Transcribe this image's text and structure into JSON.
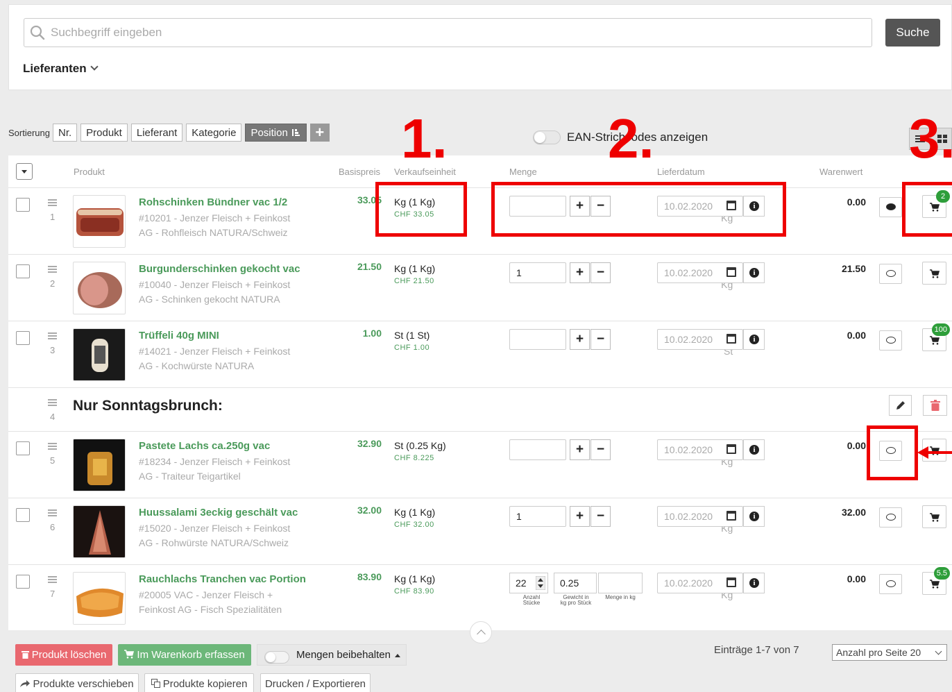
{
  "search": {
    "placeholder": "Suchbegriff eingeben",
    "button_label": "Suche",
    "suppliers_label": "Lieferanten"
  },
  "sort": {
    "label": "Sortierung",
    "buttons": [
      "Nr.",
      "Produkt",
      "Lieferant",
      "Kategorie",
      "Position"
    ],
    "active": "Position"
  },
  "ean_label": "EAN-Strichcodes anzeigen",
  "columns": {
    "product": "Produkt",
    "base_price": "Basispreis",
    "sale_unit": "Verkaufseinheit",
    "quantity": "Menge",
    "delivery_date": "Lieferdatum",
    "goods_value": "Warenwert"
  },
  "rows": [
    {
      "pos": "1",
      "name": "Rohschinken Bündner vac 1/2",
      "meta1": "#10201 - Jenzer Fleisch + Feinkost",
      "meta2": "AG - Rohfleisch NATURA/Schweiz",
      "price": "33.05",
      "price_unit": "pro Kg",
      "unit": "Kg (1 Kg)",
      "chf": "CHF 33.05",
      "qty": "",
      "date": "10.02.2020",
      "total": "0.00",
      "badge": "2",
      "comment_filled": true
    },
    {
      "pos": "2",
      "name": "Burgunderschinken gekocht vac",
      "meta1": "#10040 - Jenzer Fleisch + Feinkost",
      "meta2": "AG - Schinken gekocht NATURA",
      "price": "21.50",
      "price_unit": "pro Kg",
      "unit": "Kg (1 Kg)",
      "chf": "CHF 21.50",
      "qty": "1",
      "date": "10.02.2020",
      "total": "21.50",
      "badge": "",
      "comment_filled": false
    },
    {
      "pos": "3",
      "name": "Trüffeli 40g MINI",
      "meta1": "#14021 - Jenzer Fleisch + Feinkost",
      "meta2": "AG - Kochwürste NATURA",
      "price": "1.00",
      "price_unit": "pro St",
      "unit": "St (1 St)",
      "chf": "CHF 1.00",
      "qty": "",
      "date": "10.02.2020",
      "total": "0.00",
      "badge": "100",
      "comment_filled": false
    },
    {
      "pos": "5",
      "name": "Pastete Lachs ca.250g vac",
      "meta1": "#18234 - Jenzer Fleisch + Feinkost",
      "meta2": "AG - Traiteur Teigartikel",
      "price": "32.90",
      "price_unit": "pro Kg",
      "unit": "St (0.25 Kg)",
      "chf": "CHF 8.225",
      "qty": "",
      "date": "10.02.2020",
      "total": "0.00",
      "badge": "",
      "comment_filled": false
    },
    {
      "pos": "6",
      "name": "Huussalami 3eckig geschält vac",
      "meta1": "#15020 - Jenzer Fleisch + Feinkost",
      "meta2": "AG - Rohwürste NATURA/Schweiz",
      "price": "32.00",
      "price_unit": "pro Kg",
      "unit": "Kg (1 Kg)",
      "chf": "CHF 32.00",
      "qty": "1",
      "date": "10.02.2020",
      "total": "32.00",
      "badge": "",
      "comment_filled": false
    },
    {
      "pos": "7",
      "name": "Rauchlachs Tranchen vac Portion",
      "meta1": "#20005 VAC - Jenzer Fleisch +",
      "meta2": "Feinkost AG - Fisch Spezialitäten",
      "price": "83.90",
      "price_unit": "pro Kg",
      "unit": "Kg (1 Kg)",
      "chf": "CHF 83.90",
      "qty": "",
      "date": "10.02.2020",
      "total": "0.00",
      "badge": "5.5",
      "comment_filled": false
    }
  ],
  "section": {
    "pos": "4",
    "title": "Nur Sonntagsbrunch:"
  },
  "row7_fields": {
    "count": "22",
    "weight": "0.25",
    "amount": "",
    "count_label": "Anzahl Stücke",
    "weight_label": "Gewicht in kg pro Stück",
    "amount_label": "Menge in kg"
  },
  "annotations": [
    "1.",
    "2.",
    "3."
  ],
  "bottom": {
    "delete_label": "Produkt löschen",
    "cart_label": "Im Warenkorb erfassen",
    "keep_label": "Mengen beibehalten",
    "entries": "Einträge 1-7 von 7",
    "per_page": "Anzahl pro Seite 20",
    "move_label": "Produkte verschieben",
    "copy_label": "Produkte kopieren",
    "print_label": "Drucken / Exportieren"
  },
  "colors": {
    "accent_green": "#4a9a5a",
    "annotation_red": "#e00000",
    "badge_green": "#2e9e3a"
  }
}
